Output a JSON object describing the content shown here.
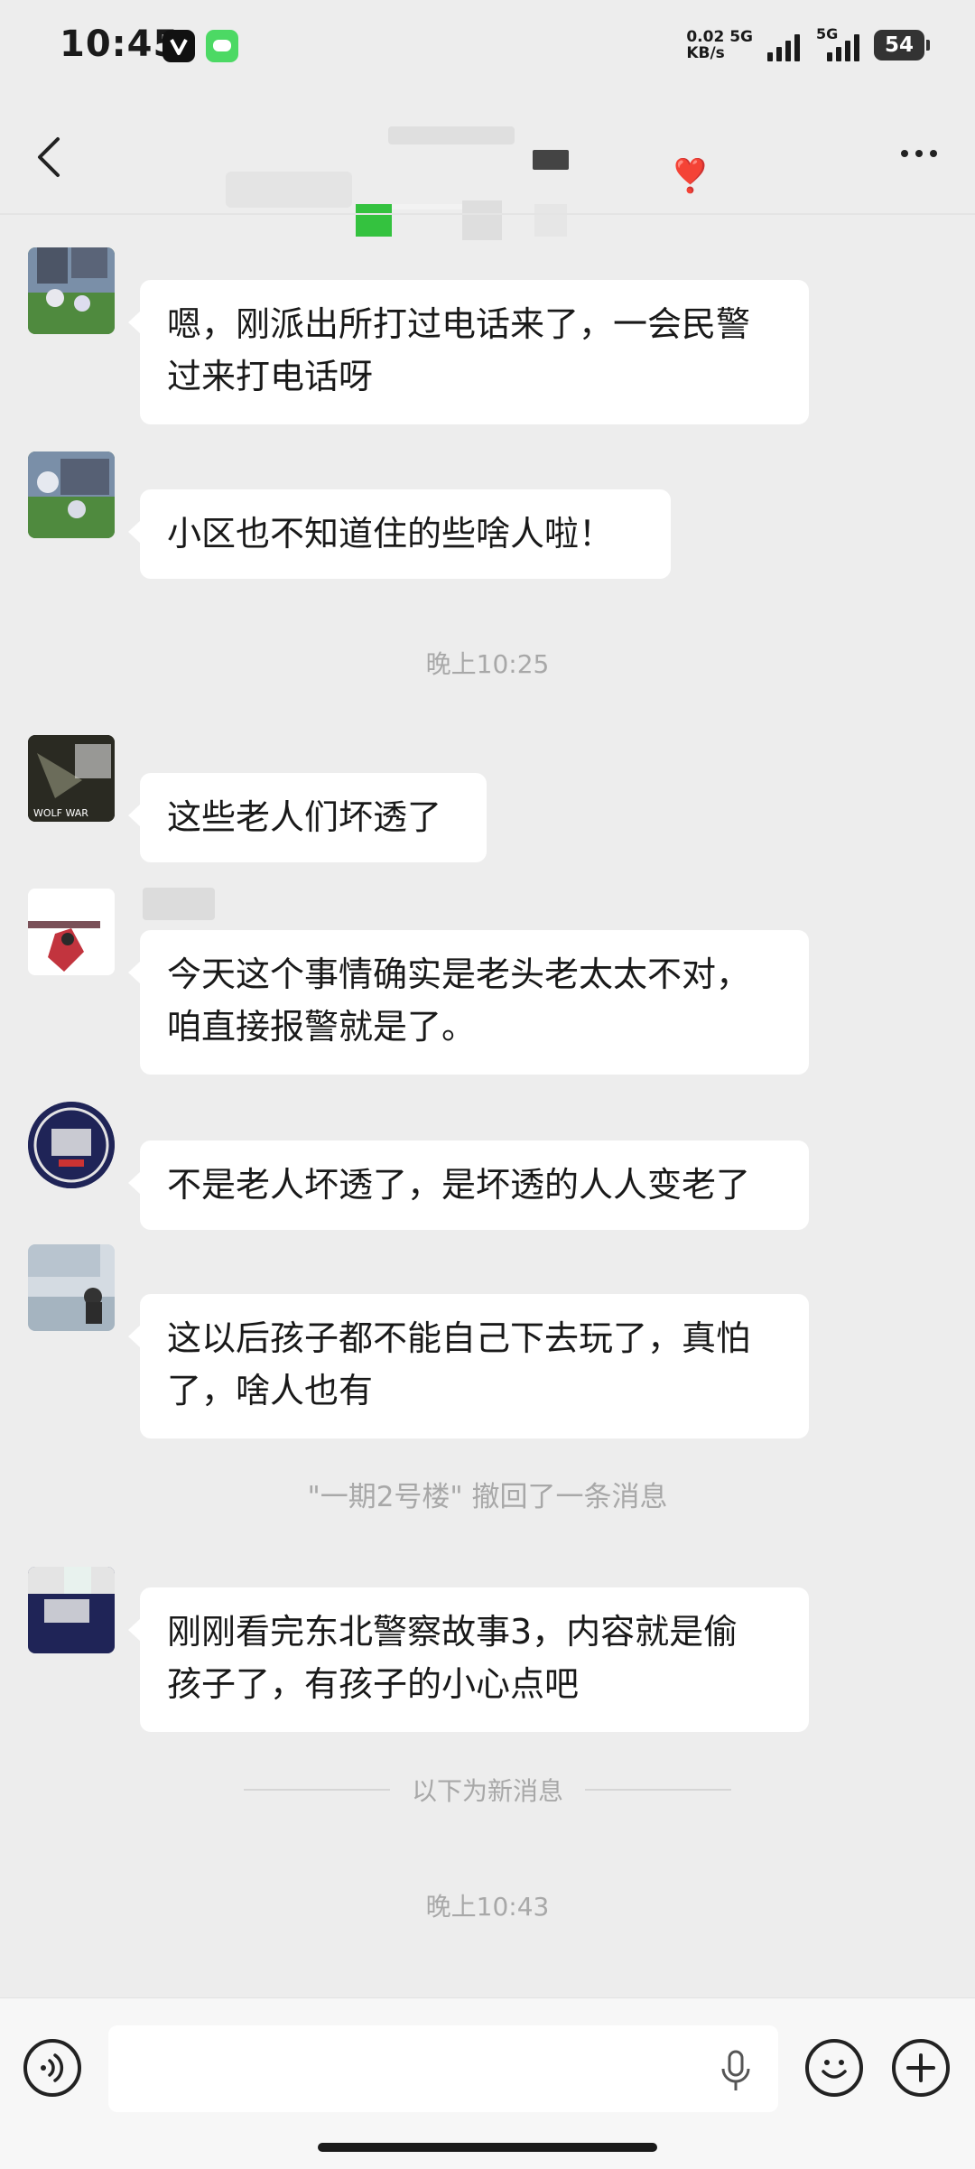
{
  "status_bar": {
    "time": "10:45",
    "net_speed_value": "0.02",
    "net_speed_unit": "KB/s",
    "network_1": "5G",
    "network_2": "5G",
    "battery": "54"
  },
  "header": {
    "back_icon": "chevron-left-icon",
    "more_icon": "more-horizontal-icon",
    "title_emoji": "❣️"
  },
  "messages": [
    {
      "text_line1": "嗯，刚派出所打过电话来了，一会民警",
      "text_line2": "过来打电话呀"
    },
    {
      "text": "小区也不知道住的些啥人啦！"
    },
    {
      "text": "这些老人们坏透了"
    },
    {
      "text_line1": "今天这个事情确实是老头老太太不对，",
      "text_line2": "咱直接报警就是了。"
    },
    {
      "text": "不是老人坏透了，是坏透的人人变老了"
    },
    {
      "text_line1": "这以后孩子都不能自己下去玩了，真怕",
      "text_line2": "了，啥人也有"
    },
    {
      "text_line1": "刚刚看完东北警察故事3，内容就是偷",
      "text_line2": "孩子了，有孩子的小心点吧"
    }
  ],
  "avatars": {
    "a3_caption": "WOLF WAR"
  },
  "timestamps": {
    "t1": "晚上10:25",
    "t2": "晚上10:43"
  },
  "system": {
    "recall_note": "\"一期2号楼\" 撤回了一条消息",
    "new_messages_divider": "以下为新消息"
  },
  "input_bar": {
    "voice_icon": "voice-icon",
    "mic_icon": "microphone-icon",
    "emoji_icon": "emoji-icon",
    "plus_icon": "plus-icon",
    "input_value": ""
  },
  "colors": {
    "background": "#ededed",
    "bubble": "#ffffff",
    "meta_text": "#a8a8a8"
  }
}
